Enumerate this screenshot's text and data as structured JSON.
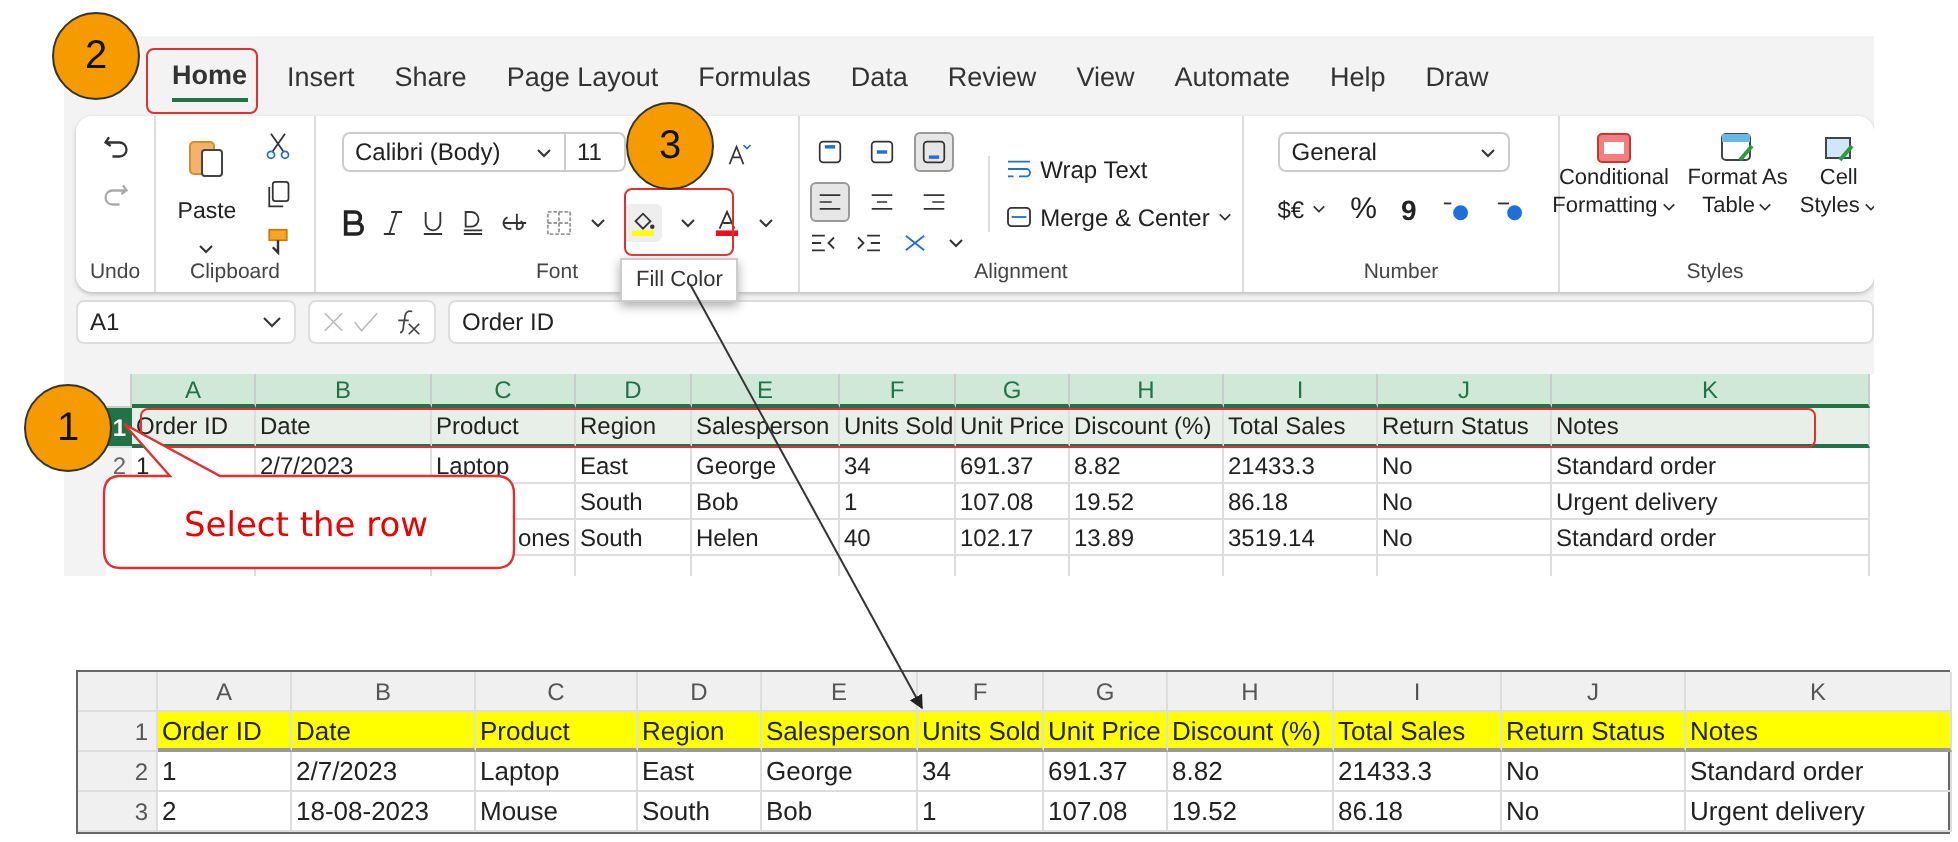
{
  "ribbon_tabs": [
    {
      "label": "Home",
      "selected": true
    },
    {
      "label": "Insert",
      "selected": false
    },
    {
      "label": "Share",
      "selected": false
    },
    {
      "label": "Page Layout",
      "selected": false
    },
    {
      "label": "Formulas",
      "selected": false
    },
    {
      "label": "Data",
      "selected": false
    },
    {
      "label": "Review",
      "selected": false
    },
    {
      "label": "View",
      "selected": false
    },
    {
      "label": "Automate",
      "selected": false
    },
    {
      "label": "Help",
      "selected": false
    },
    {
      "label": "Draw",
      "selected": false
    }
  ],
  "ribbon": {
    "undo_group": "Undo",
    "clipboard": {
      "paste": "Paste",
      "label": "Clipboard"
    },
    "font": {
      "family": "Calibri (Body)",
      "size": "11",
      "label": "Font",
      "tooltip": "Fill Color"
    },
    "alignment": {
      "vertical": [
        {
          "kind": "top",
          "selected": false
        },
        {
          "kind": "middle",
          "selected": false
        },
        {
          "kind": "bottom",
          "selected": true
        }
      ],
      "horizontal": [
        {
          "kind": "left",
          "selected": true
        },
        {
          "kind": "center",
          "selected": false
        },
        {
          "kind": "right",
          "selected": false
        }
      ],
      "wrap": "Wrap Text",
      "merge": "Merge & Center",
      "label": "Alignment"
    },
    "number": {
      "format": "General",
      "currency": "$€",
      "percent": "%",
      "comma": "9",
      "label": "Number"
    },
    "styles": {
      "buttons": [
        {
          "kind": "conditional",
          "line1": "Conditional",
          "line2": "Formatting"
        },
        {
          "kind": "table",
          "line1": "Format As",
          "line2": "Table"
        },
        {
          "kind": "cell",
          "line1": "Cell",
          "line2": "Styles"
        }
      ],
      "label": "Styles"
    }
  },
  "formula_bar": {
    "name_box": "A1",
    "formula": "Order ID"
  },
  "sheet": {
    "columns": [
      "A",
      "B",
      "C",
      "D",
      "E",
      "F",
      "G",
      "H",
      "I",
      "J",
      "K"
    ],
    "rows": [
      {
        "number": "1",
        "selected": true,
        "cells": [
          "Order ID",
          "Date",
          "Product",
          "Region",
          "Salesperson",
          "Units Sold",
          "Unit Price",
          "Discount (%)",
          "Total Sales",
          "Return Status",
          "Notes"
        ]
      },
      {
        "number": "2",
        "selected": false,
        "cells": [
          "1",
          "2/7/2023",
          "Laptop",
          "East",
          "George",
          "34",
          "691.37",
          "8.82",
          "21433.3",
          "No",
          "Standard order"
        ]
      },
      {
        "number": null,
        "selected": false,
        "cells": [
          null,
          null,
          null,
          "South",
          "Bob",
          "1",
          "107.08",
          "19.52",
          "86.18",
          "No",
          "Urgent delivery"
        ]
      },
      {
        "number": null,
        "selected": false,
        "cells": [
          null,
          null,
          {
            "text": "ones",
            "cut": true
          },
          "South",
          "Helen",
          "40",
          "102.17",
          "13.89",
          "3519.14",
          "No",
          "Standard order"
        ]
      }
    ]
  },
  "markers": [
    {
      "label": "2"
    },
    {
      "label": "3"
    },
    {
      "label": "1"
    }
  ],
  "callout": "Select the row",
  "result_sheet": {
    "columns": [
      "A",
      "B",
      "C",
      "D",
      "E",
      "F",
      "G",
      "H",
      "I",
      "J",
      "K"
    ],
    "rows": [
      {
        "number": "1",
        "highlighted": true,
        "cells": [
          "Order ID",
          "Date",
          "Product",
          "Region",
          "Salesperson",
          "Units Sold",
          "Unit Price",
          "Discount (%)",
          "Total Sales",
          "Return Status",
          "Notes"
        ]
      },
      {
        "number": "2",
        "highlighted": false,
        "cells": [
          "1",
          "2/7/2023",
          "Laptop",
          "East",
          "George",
          "34",
          "691.37",
          "8.82",
          "21433.3",
          "No",
          "Standard order"
        ]
      },
      {
        "number": "3",
        "highlighted": false,
        "cells": [
          "2",
          "18-08-2023",
          "Mouse",
          "South",
          "Bob",
          "1",
          "107.08",
          "19.52",
          "86.18",
          "No",
          "Urgent delivery"
        ]
      }
    ]
  }
}
